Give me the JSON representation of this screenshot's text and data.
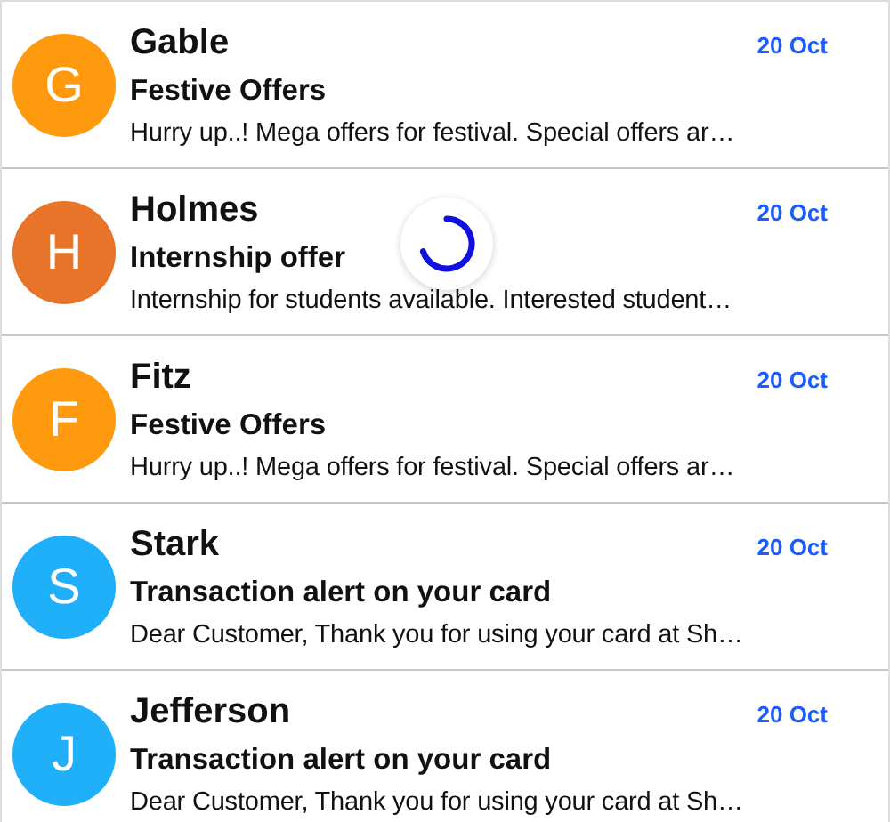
{
  "messages": [
    {
      "initial": "G",
      "color": "#ff9a0e",
      "sender": "Gable",
      "date": "20 Oct",
      "subject": "Festive Offers",
      "preview": "Hurry up..! Mega offers for festival. Special offers ar…"
    },
    {
      "initial": "H",
      "color": "#e8742a",
      "sender": "Holmes",
      "date": "20 Oct",
      "subject": "Internship offer",
      "preview": "Internship for students available. Interested student…"
    },
    {
      "initial": "F",
      "color": "#ff9a0e",
      "sender": "Fitz",
      "date": "20 Oct",
      "subject": "Festive Offers",
      "preview": "Hurry up..! Mega offers for festival. Special offers ar…"
    },
    {
      "initial": "S",
      "color": "#1fb0f9",
      "sender": "Stark",
      "date": "20 Oct",
      "subject": "Transaction alert on your card",
      "preview": "Dear Customer, Thank you for using your card at Sh…"
    },
    {
      "initial": "J",
      "color": "#1fb0f9",
      "sender": "Jefferson",
      "date": "20 Oct",
      "subject": "Transaction alert on your card",
      "preview": "Dear Customer, Thank you for using your card at Sh…"
    }
  ],
  "loading": true
}
